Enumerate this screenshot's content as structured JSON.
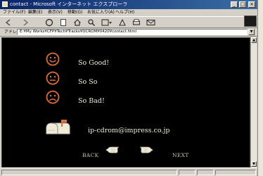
{
  "window": {
    "title": "contact - Microsoft インターネット エクスプローラ",
    "minimize": "_",
    "maximize": "□",
    "close": "×"
  },
  "menu": [
    "ファイル(F)",
    "編集(E)",
    "表示(V)",
    "移動(G)",
    "お気に入り(A)",
    "ヘルプ(H)"
  ],
  "toolbar": [
    "back-icon",
    "forward-icon",
    "stop-icon",
    "refresh-icon",
    "home-icon",
    "search-icon",
    "favorites-icon",
    "history-icon",
    "print-icon",
    "mail-icon"
  ],
  "address": {
    "label": "アドレス",
    "value": "E:¥My Works¥CFP¥Tech¥Tracks¥DCROM¥0420¥contact.html"
  },
  "page": {
    "rows": [
      {
        "mood": "good",
        "icon": "smiley-face-icon",
        "label": "So Good!"
      },
      {
        "mood": "soso",
        "icon": "neutral-face-icon",
        "label": "So So"
      },
      {
        "mood": "bad",
        "icon": "sad-face-icon",
        "label": "So Bad!"
      }
    ],
    "email": "ip-cdrom@impress.co.jp",
    "back_label": "BACK",
    "next_label": "NEXT"
  },
  "colors": {
    "face": "#d8703c",
    "text": "#f0ead8",
    "content_bg": "#000000"
  }
}
